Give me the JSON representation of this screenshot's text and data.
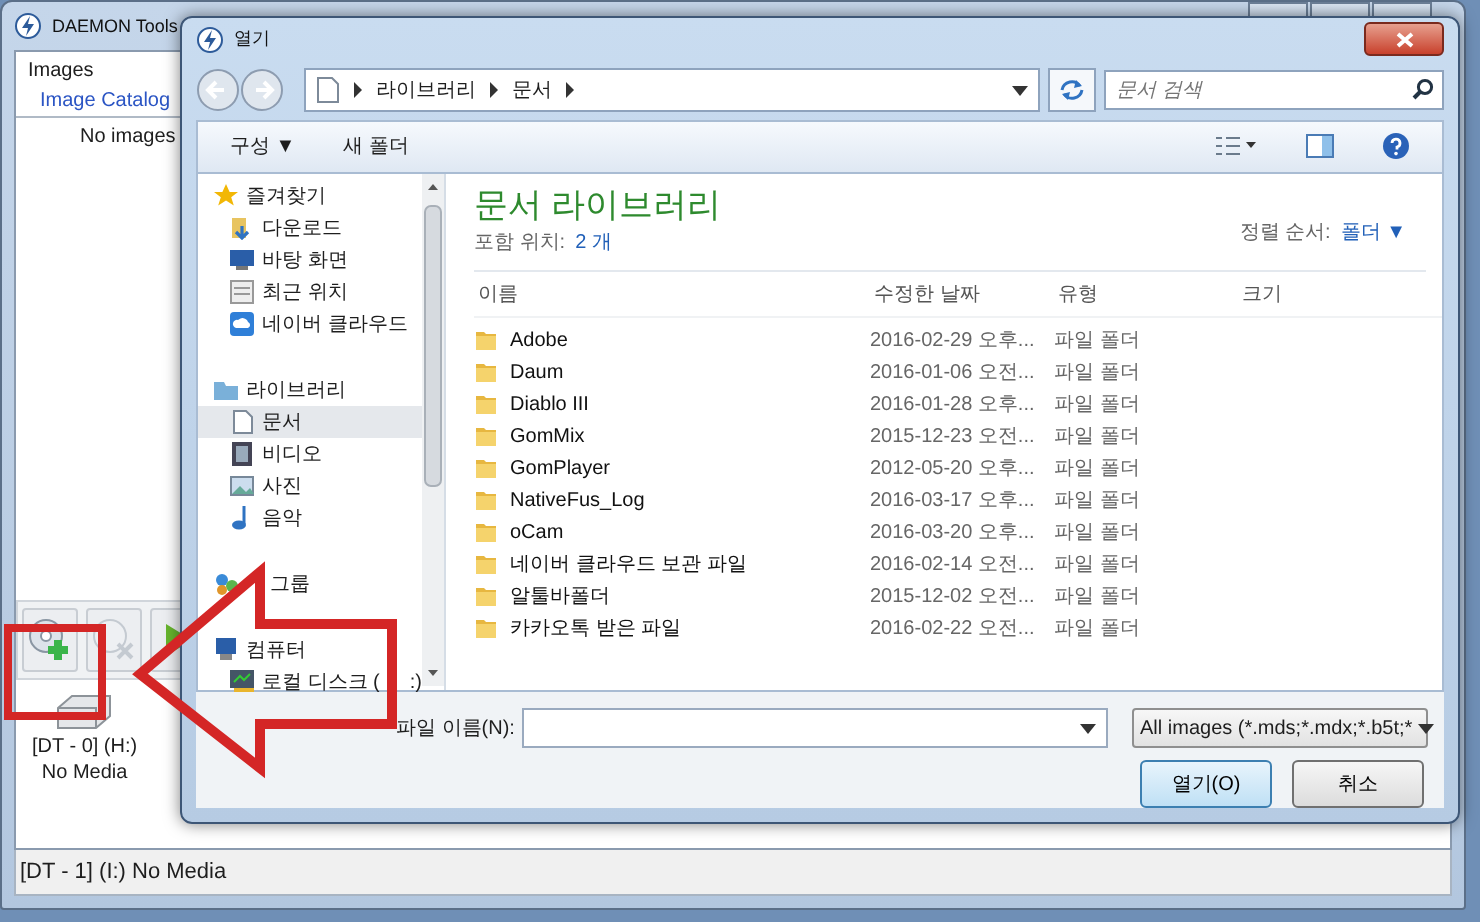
{
  "app_window": {
    "title": "DAEMON Tools",
    "panel_header": "Images",
    "tabs": [
      {
        "label": "Image Catalog",
        "selected": true
      }
    ],
    "empty_text": "No images",
    "drive": {
      "name": "[DT - 0] (H:)",
      "status": "No Media"
    },
    "status_bar": "[DT - 1] (I:) No Media"
  },
  "dialog": {
    "title": "열기",
    "breadcrumb": [
      "라이브러리",
      "문서"
    ],
    "search": {
      "placeholder": "문서 검색"
    },
    "toolbar": [
      "구성 ▼",
      "새 폴더"
    ],
    "nav": [
      {
        "label": "즐겨찾기",
        "children": [
          {
            "label": "다운로드",
            "selected": false
          },
          {
            "label": "바탕 화면",
            "selected": false
          },
          {
            "label": "최근 위치",
            "selected": false
          },
          {
            "label": "네이버 클라우드",
            "selected": false
          }
        ]
      },
      {
        "label": "라이브러리",
        "children": [
          {
            "label": "문서",
            "selected": true
          },
          {
            "label": "비디오",
            "selected": false
          },
          {
            "label": "사진",
            "selected": false
          },
          {
            "label": "음악",
            "selected": false
          }
        ]
      },
      {
        "label": "그룹"
      },
      {
        "label": "컴퓨터",
        "children": [
          {
            "label": "로컬 디스크 (",
            "label_tail": ":)",
            "selected": false
          }
        ]
      }
    ],
    "library_title": "문서 라이브러리",
    "includes_label": "포함 위치:",
    "includes_link": "2 개",
    "sort_label": "정렬 순서:",
    "sort_value": "폴더 ▼",
    "columns": [
      "이름",
      "수정한 날짜",
      "유형",
      "크기"
    ],
    "rows": [
      {
        "name": "Adobe",
        "date": "2016-02-29 오후...",
        "type": "파일 폴더"
      },
      {
        "name": "Daum",
        "date": "2016-01-06 오전...",
        "type": "파일 폴더"
      },
      {
        "name": "Diablo III",
        "date": "2016-01-28 오후...",
        "type": "파일 폴더"
      },
      {
        "name": "GomMix",
        "date": "2015-12-23 오전...",
        "type": "파일 폴더"
      },
      {
        "name": "GomPlayer",
        "date": "2012-05-20 오후...",
        "type": "파일 폴더"
      },
      {
        "name": "NativeFus_Log",
        "date": "2016-03-17 오후...",
        "type": "파일 폴더"
      },
      {
        "name": "oCam",
        "date": "2016-03-20 오후...",
        "type": "파일 폴더"
      },
      {
        "name": "네이버 클라우드 보관 파일",
        "date": "2016-02-14 오전...",
        "type": "파일 폴더"
      },
      {
        "name": "알툴바폴더",
        "date": "2015-12-02 오전...",
        "type": "파일 폴더"
      },
      {
        "name": "카카오톡 받은 파일",
        "date": "2016-02-22 오전...",
        "type": "파일 폴더"
      }
    ],
    "filename_label": "파일 이름(N):",
    "filter": "All images (*.mds;*.mdx;*.b5t;*",
    "buttons": [
      "열기(O)",
      "취소"
    ]
  }
}
